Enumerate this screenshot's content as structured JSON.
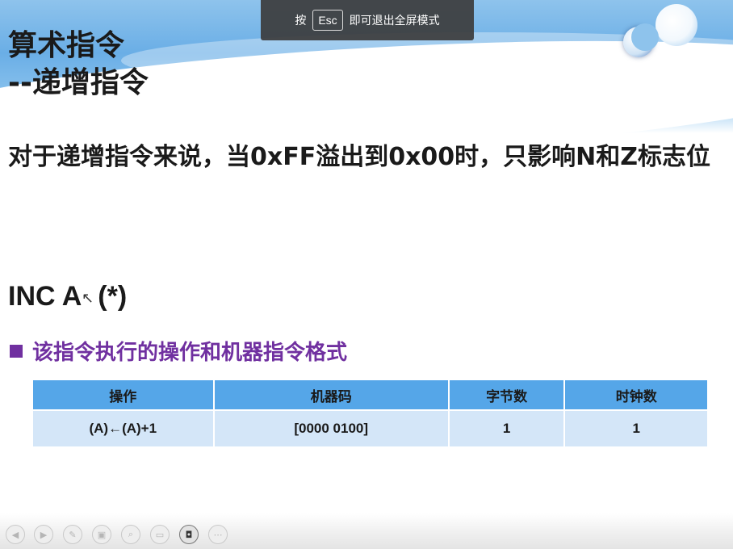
{
  "slide": {
    "title_line1": "算术指令",
    "title_line2": "--递增指令",
    "description": "对于递增指令来说，当0xFF溢出到0x00时，只影响N和Z标志位",
    "instruction": "INC A",
    "instruction_note": "(*)",
    "bullet": "该指令执行的操作和机器指令格式",
    "table": {
      "headers": [
        "操作",
        "机器码",
        "字节数",
        "时钟数"
      ],
      "rows": [
        [
          "(A)←(A)+1",
          "[0000 0100]",
          "1",
          "1"
        ]
      ]
    }
  },
  "fullscreen_toast": {
    "prefix": "按",
    "key": "Esc",
    "suffix": "即可退出全屏模式"
  },
  "toolbar": {
    "buttons": [
      {
        "icon": "previous-icon",
        "glyph": "◀"
      },
      {
        "icon": "next-icon",
        "glyph": "▶"
      },
      {
        "icon": "pen-icon",
        "glyph": "✎"
      },
      {
        "icon": "slides-icon",
        "glyph": "▣"
      },
      {
        "icon": "zoom-icon",
        "glyph": "⌕"
      },
      {
        "icon": "subtitles-icon",
        "glyph": "▭"
      },
      {
        "icon": "camera-icon",
        "glyph": "◘"
      },
      {
        "icon": "more-icon",
        "glyph": "⋯"
      }
    ]
  },
  "colors": {
    "banner": "#6aaee6",
    "bullet": "#7030a0",
    "table_header": "#55a6e8",
    "table_cell": "#d4e6f8"
  }
}
